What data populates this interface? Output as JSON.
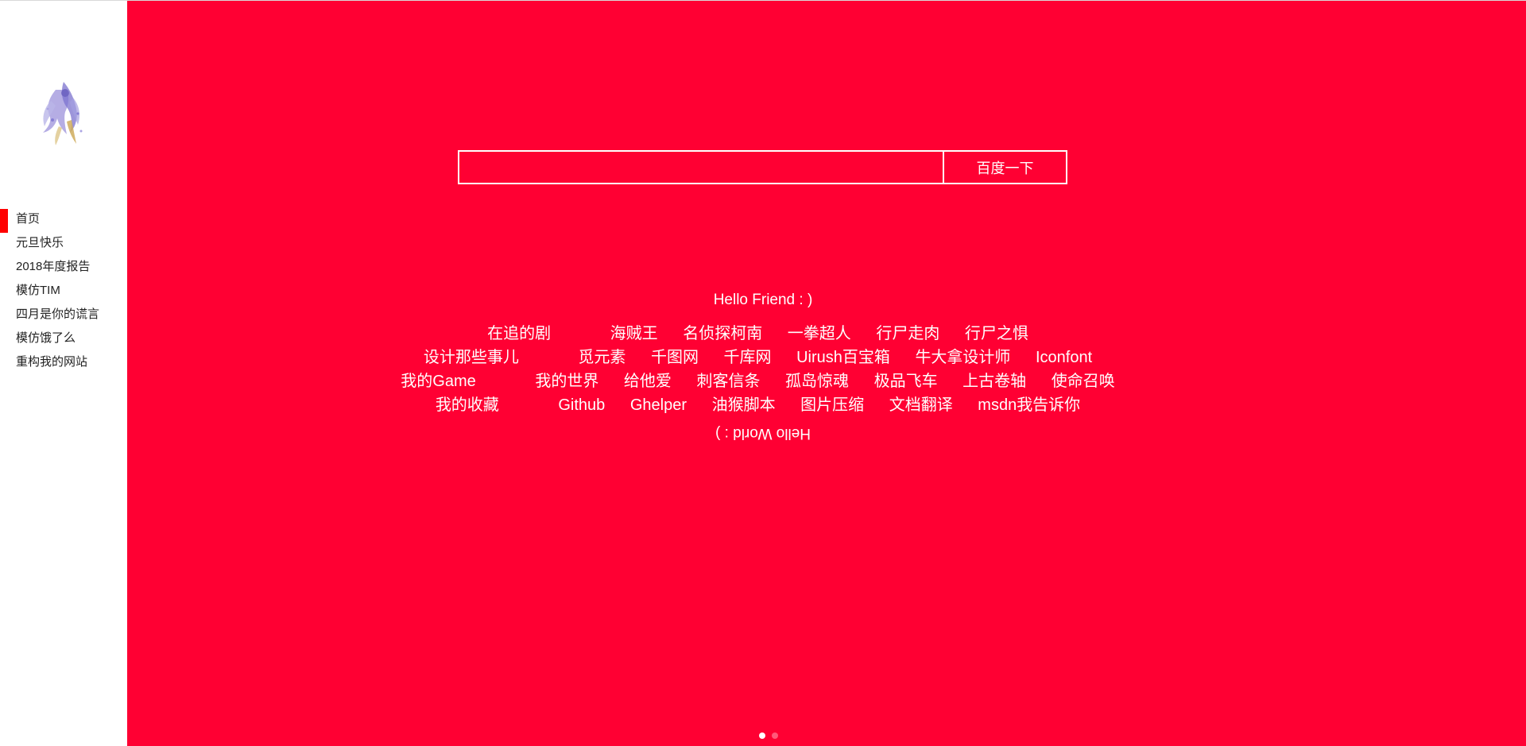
{
  "sidebar": {
    "avatar_icon": "anime-character-avatar-icon",
    "items": [
      {
        "label": "首页",
        "active": true
      },
      {
        "label": "元旦快乐",
        "active": false
      },
      {
        "label": "2018年度报告",
        "active": false
      },
      {
        "label": "模仿TIM",
        "active": false
      },
      {
        "label": "四月是你的谎言",
        "active": false
      },
      {
        "label": "模仿饿了么",
        "active": false
      },
      {
        "label": "重构我的网站",
        "active": false
      }
    ]
  },
  "search": {
    "placeholder": "",
    "value": "",
    "button_label": "百度一下"
  },
  "greeting": "Hello Friend : )",
  "link_rows": [
    {
      "title": "在追的剧",
      "links": [
        "海贼王",
        "名侦探柯南",
        "一拳超人",
        "行尸走肉",
        "行尸之惧"
      ]
    },
    {
      "title": "设计那些事儿",
      "links": [
        "觅元素",
        "千图网",
        "千库网",
        "Uirush百宝箱",
        "牛大拿设计师",
        "Iconfont"
      ]
    },
    {
      "title": "我的Game",
      "links": [
        "我的世界",
        "给他爱",
        "刺客信条",
        "孤岛惊魂",
        "极品飞车",
        "上古卷轴",
        "使命召唤"
      ]
    },
    {
      "title": "我的收藏",
      "links": [
        "Github",
        "Ghelper",
        "油猴脚本",
        "图片压缩",
        "文档翻译",
        "msdn我告诉你"
      ]
    }
  ],
  "farewell": "Hello World : )",
  "pagination": {
    "pages": 2,
    "current": 1
  },
  "colors": {
    "main_background": "#ff0033",
    "active_indicator": "#ff0000",
    "text_on_red": "#ffffff",
    "sidebar_text": "#222222"
  }
}
